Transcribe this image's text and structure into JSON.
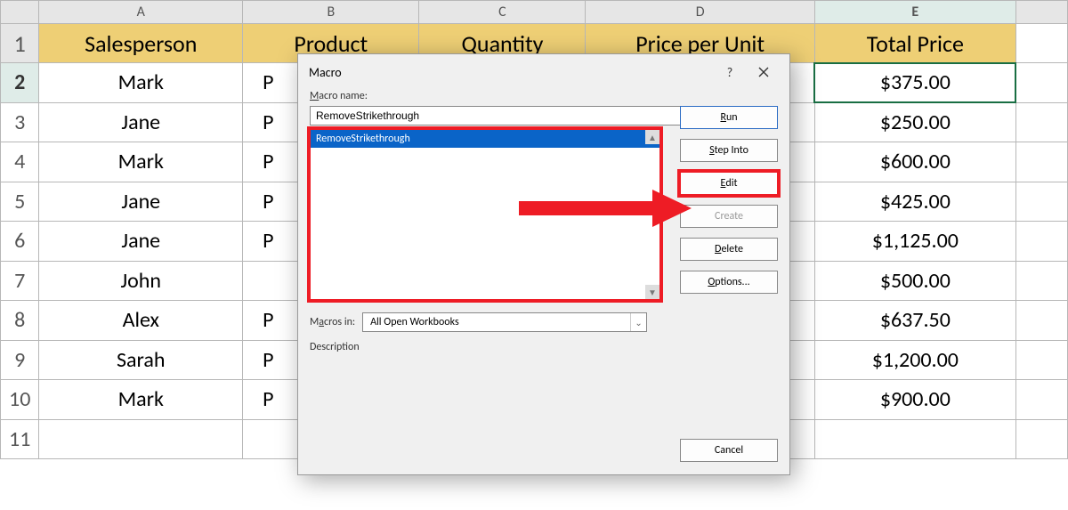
{
  "columns": [
    "A",
    "B",
    "C",
    "D",
    "E"
  ],
  "headers": {
    "A": "Salesperson",
    "B": "Product",
    "C": "Quantity",
    "D": "Price per Unit",
    "E": "Total Price",
    "E_partial": "t"
  },
  "rows": [
    {
      "n": "1"
    },
    {
      "n": "2",
      "A": "Mark",
      "B": "P",
      "E": "$375.00"
    },
    {
      "n": "3",
      "A": "Jane",
      "B": "P",
      "E": "$250.00"
    },
    {
      "n": "4",
      "A": "Mark",
      "B": "P",
      "E": "$600.00"
    },
    {
      "n": "5",
      "A": "Jane",
      "B": "P",
      "E": "$425.00"
    },
    {
      "n": "6",
      "A": "Jane",
      "B": "P",
      "E": "$1,125.00"
    },
    {
      "n": "7",
      "A": "John",
      "E": "$500.00"
    },
    {
      "n": "8",
      "A": "Alex",
      "B": "P",
      "E": "$637.50"
    },
    {
      "n": "9",
      "A": "Sarah",
      "B": "P",
      "E": "$1,200.00"
    },
    {
      "n": "10",
      "A": "Mark",
      "B": "P",
      "E": "$900.00"
    },
    {
      "n": "11"
    }
  ],
  "dialog": {
    "title": "Macro",
    "macro_name_label": "Macro name:",
    "macro_name_value": "RemoveStrikethrough",
    "list_selected": "RemoveStrikethrough",
    "macros_in_label": "Macros in:",
    "macros_in_value": "All Open Workbooks",
    "description_label": "Description",
    "buttons": {
      "run": "Run",
      "step": "Step Into",
      "edit": "Edit",
      "create": "Create",
      "delete": "Delete",
      "options": "Options...",
      "cancel": "Cancel"
    }
  }
}
